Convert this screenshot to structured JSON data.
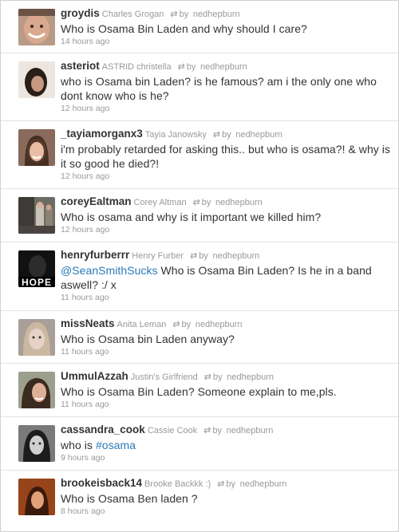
{
  "retweet_prefix": "by",
  "tweets": [
    {
      "username": "groydis",
      "fullname": "Charles Grogan",
      "retweeted_by": "nedhepburn",
      "text_pre": "Who is Osama Bin Laden and why should I care?",
      "link": "",
      "text_post": "",
      "time": "14 hours ago",
      "avatar_icon": "avatar-man-smiling"
    },
    {
      "username": "asteriot",
      "fullname": "ASTRID christella",
      "retweeted_by": "nedhepburn",
      "text_pre": "who is Osama bin Laden? is he famous? am i the only one who dont know who is he?",
      "link": "",
      "text_post": "",
      "time": "12 hours ago",
      "avatar_icon": "avatar-woman-dark-hair"
    },
    {
      "username": "_tayiamorganx3",
      "fullname": "Tayia Janowsky",
      "retweeted_by": "nedhepburn",
      "text_pre": "i'm probably retarded for asking this.. but who is osama?! & why is it so good he died?!",
      "link": "",
      "text_post": "",
      "time": "12 hours ago",
      "avatar_icon": "avatar-woman-smiling"
    },
    {
      "username": "coreyEaltman",
      "fullname": "Corey Altman",
      "retweeted_by": "nedhepburn",
      "text_pre": "Who is osama and why is it important we killed him?",
      "link": "",
      "text_post": "",
      "time": "12 hours ago",
      "avatar_icon": "avatar-group-stairs"
    },
    {
      "username": "henryfurberrr",
      "fullname": "Henry Furber",
      "retweeted_by": "nedhepburn",
      "text_pre": "",
      "link": "@SeanSmithSucks",
      "text_post": " Who is Osama Bin Laden? Is he in a band aswell? :/ x",
      "time": "11 hours ago",
      "avatar_icon": "avatar-hope-poster",
      "avatar_text": "HOPE"
    },
    {
      "username": "missNeats",
      "fullname": "Anita Leman",
      "retweeted_by": "nedhepburn",
      "text_pre": "Who is Osama bin Laden anyway?",
      "link": "",
      "text_post": "",
      "time": "11 hours ago",
      "avatar_icon": "avatar-woman-blonde"
    },
    {
      "username": "UmmulAzzah",
      "fullname": "Justin's Girlfriend",
      "retweeted_by": "nedhepburn",
      "text_pre": "Who is Osama Bin Laden? Someone explain to me,pls.",
      "link": "",
      "text_post": "",
      "time": "11 hours ago",
      "avatar_icon": "avatar-woman-side"
    },
    {
      "username": "cassandra_cook",
      "fullname": "Cassie Cook",
      "retweeted_by": "nedhepburn",
      "text_pre": "who is ",
      "link": "#osama",
      "text_post": "",
      "time": "9 hours ago",
      "avatar_icon": "avatar-woman-bw"
    },
    {
      "username": "brookeisback14",
      "fullname": "Brooke Backkk :)",
      "retweeted_by": "nedhepburn",
      "text_pre": "Who is Osama Ben laden ?",
      "link": "",
      "text_post": "",
      "time": "8 hours ago",
      "avatar_icon": "avatar-woman-orange"
    }
  ]
}
